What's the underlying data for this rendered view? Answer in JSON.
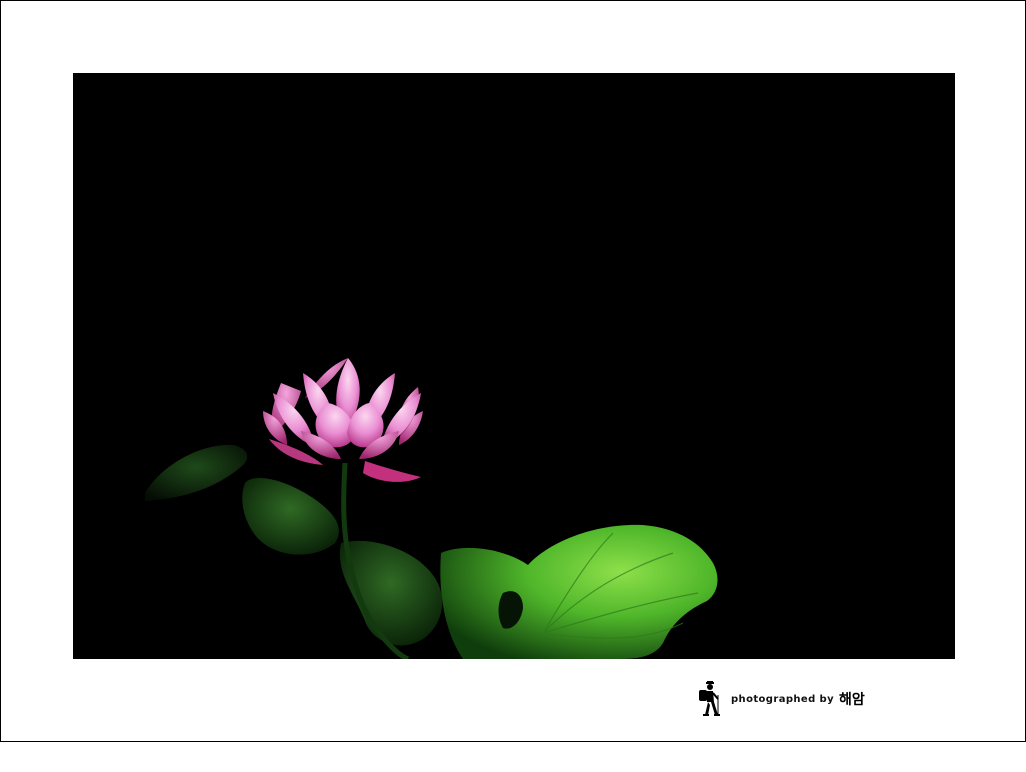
{
  "photo": {
    "subject": "pink-lotus-flower",
    "background_color": "#000000",
    "frame_color": "#ffffff",
    "petal_color": "#e07cc4",
    "leaf_color": "#4fb62a"
  },
  "credit": {
    "prefix": "photographed by",
    "signature": "해암",
    "icon": "hiker-icon"
  }
}
